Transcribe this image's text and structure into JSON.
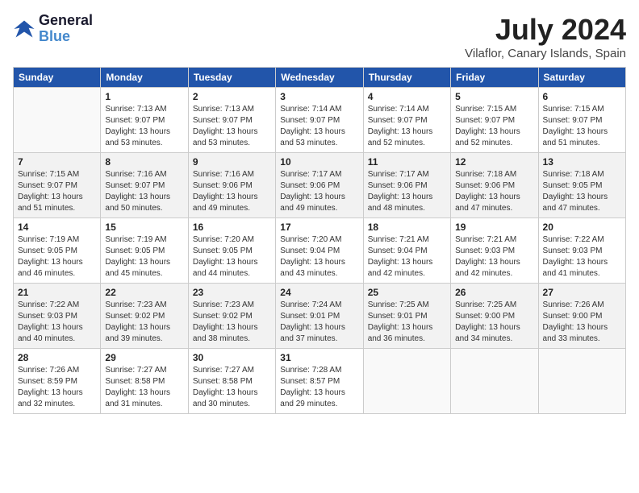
{
  "header": {
    "logo_line1": "General",
    "logo_line2": "Blue",
    "month_year": "July 2024",
    "location": "Vilaflor, Canary Islands, Spain"
  },
  "weekdays": [
    "Sunday",
    "Monday",
    "Tuesday",
    "Wednesday",
    "Thursday",
    "Friday",
    "Saturday"
  ],
  "weeks": [
    [
      {
        "day": "",
        "sunrise": "",
        "sunset": "",
        "daylight": ""
      },
      {
        "day": "1",
        "sunrise": "Sunrise: 7:13 AM",
        "sunset": "Sunset: 9:07 PM",
        "daylight": "Daylight: 13 hours and 53 minutes."
      },
      {
        "day": "2",
        "sunrise": "Sunrise: 7:13 AM",
        "sunset": "Sunset: 9:07 PM",
        "daylight": "Daylight: 13 hours and 53 minutes."
      },
      {
        "day": "3",
        "sunrise": "Sunrise: 7:14 AM",
        "sunset": "Sunset: 9:07 PM",
        "daylight": "Daylight: 13 hours and 53 minutes."
      },
      {
        "day": "4",
        "sunrise": "Sunrise: 7:14 AM",
        "sunset": "Sunset: 9:07 PM",
        "daylight": "Daylight: 13 hours and 52 minutes."
      },
      {
        "day": "5",
        "sunrise": "Sunrise: 7:15 AM",
        "sunset": "Sunset: 9:07 PM",
        "daylight": "Daylight: 13 hours and 52 minutes."
      },
      {
        "day": "6",
        "sunrise": "Sunrise: 7:15 AM",
        "sunset": "Sunset: 9:07 PM",
        "daylight": "Daylight: 13 hours and 51 minutes."
      }
    ],
    [
      {
        "day": "7",
        "sunrise": "Sunrise: 7:15 AM",
        "sunset": "Sunset: 9:07 PM",
        "daylight": "Daylight: 13 hours and 51 minutes."
      },
      {
        "day": "8",
        "sunrise": "Sunrise: 7:16 AM",
        "sunset": "Sunset: 9:07 PM",
        "daylight": "Daylight: 13 hours and 50 minutes."
      },
      {
        "day": "9",
        "sunrise": "Sunrise: 7:16 AM",
        "sunset": "Sunset: 9:06 PM",
        "daylight": "Daylight: 13 hours and 49 minutes."
      },
      {
        "day": "10",
        "sunrise": "Sunrise: 7:17 AM",
        "sunset": "Sunset: 9:06 PM",
        "daylight": "Daylight: 13 hours and 49 minutes."
      },
      {
        "day": "11",
        "sunrise": "Sunrise: 7:17 AM",
        "sunset": "Sunset: 9:06 PM",
        "daylight": "Daylight: 13 hours and 48 minutes."
      },
      {
        "day": "12",
        "sunrise": "Sunrise: 7:18 AM",
        "sunset": "Sunset: 9:06 PM",
        "daylight": "Daylight: 13 hours and 47 minutes."
      },
      {
        "day": "13",
        "sunrise": "Sunrise: 7:18 AM",
        "sunset": "Sunset: 9:05 PM",
        "daylight": "Daylight: 13 hours and 47 minutes."
      }
    ],
    [
      {
        "day": "14",
        "sunrise": "Sunrise: 7:19 AM",
        "sunset": "Sunset: 9:05 PM",
        "daylight": "Daylight: 13 hours and 46 minutes."
      },
      {
        "day": "15",
        "sunrise": "Sunrise: 7:19 AM",
        "sunset": "Sunset: 9:05 PM",
        "daylight": "Daylight: 13 hours and 45 minutes."
      },
      {
        "day": "16",
        "sunrise": "Sunrise: 7:20 AM",
        "sunset": "Sunset: 9:05 PM",
        "daylight": "Daylight: 13 hours and 44 minutes."
      },
      {
        "day": "17",
        "sunrise": "Sunrise: 7:20 AM",
        "sunset": "Sunset: 9:04 PM",
        "daylight": "Daylight: 13 hours and 43 minutes."
      },
      {
        "day": "18",
        "sunrise": "Sunrise: 7:21 AM",
        "sunset": "Sunset: 9:04 PM",
        "daylight": "Daylight: 13 hours and 42 minutes."
      },
      {
        "day": "19",
        "sunrise": "Sunrise: 7:21 AM",
        "sunset": "Sunset: 9:03 PM",
        "daylight": "Daylight: 13 hours and 42 minutes."
      },
      {
        "day": "20",
        "sunrise": "Sunrise: 7:22 AM",
        "sunset": "Sunset: 9:03 PM",
        "daylight": "Daylight: 13 hours and 41 minutes."
      }
    ],
    [
      {
        "day": "21",
        "sunrise": "Sunrise: 7:22 AM",
        "sunset": "Sunset: 9:03 PM",
        "daylight": "Daylight: 13 hours and 40 minutes."
      },
      {
        "day": "22",
        "sunrise": "Sunrise: 7:23 AM",
        "sunset": "Sunset: 9:02 PM",
        "daylight": "Daylight: 13 hours and 39 minutes."
      },
      {
        "day": "23",
        "sunrise": "Sunrise: 7:23 AM",
        "sunset": "Sunset: 9:02 PM",
        "daylight": "Daylight: 13 hours and 38 minutes."
      },
      {
        "day": "24",
        "sunrise": "Sunrise: 7:24 AM",
        "sunset": "Sunset: 9:01 PM",
        "daylight": "Daylight: 13 hours and 37 minutes."
      },
      {
        "day": "25",
        "sunrise": "Sunrise: 7:25 AM",
        "sunset": "Sunset: 9:01 PM",
        "daylight": "Daylight: 13 hours and 36 minutes."
      },
      {
        "day": "26",
        "sunrise": "Sunrise: 7:25 AM",
        "sunset": "Sunset: 9:00 PM",
        "daylight": "Daylight: 13 hours and 34 minutes."
      },
      {
        "day": "27",
        "sunrise": "Sunrise: 7:26 AM",
        "sunset": "Sunset: 9:00 PM",
        "daylight": "Daylight: 13 hours and 33 minutes."
      }
    ],
    [
      {
        "day": "28",
        "sunrise": "Sunrise: 7:26 AM",
        "sunset": "Sunset: 8:59 PM",
        "daylight": "Daylight: 13 hours and 32 minutes."
      },
      {
        "day": "29",
        "sunrise": "Sunrise: 7:27 AM",
        "sunset": "Sunset: 8:58 PM",
        "daylight": "Daylight: 13 hours and 31 minutes."
      },
      {
        "day": "30",
        "sunrise": "Sunrise: 7:27 AM",
        "sunset": "Sunset: 8:58 PM",
        "daylight": "Daylight: 13 hours and 30 minutes."
      },
      {
        "day": "31",
        "sunrise": "Sunrise: 7:28 AM",
        "sunset": "Sunset: 8:57 PM",
        "daylight": "Daylight: 13 hours and 29 minutes."
      },
      {
        "day": "",
        "sunrise": "",
        "sunset": "",
        "daylight": ""
      },
      {
        "day": "",
        "sunrise": "",
        "sunset": "",
        "daylight": ""
      },
      {
        "day": "",
        "sunrise": "",
        "sunset": "",
        "daylight": ""
      }
    ]
  ]
}
